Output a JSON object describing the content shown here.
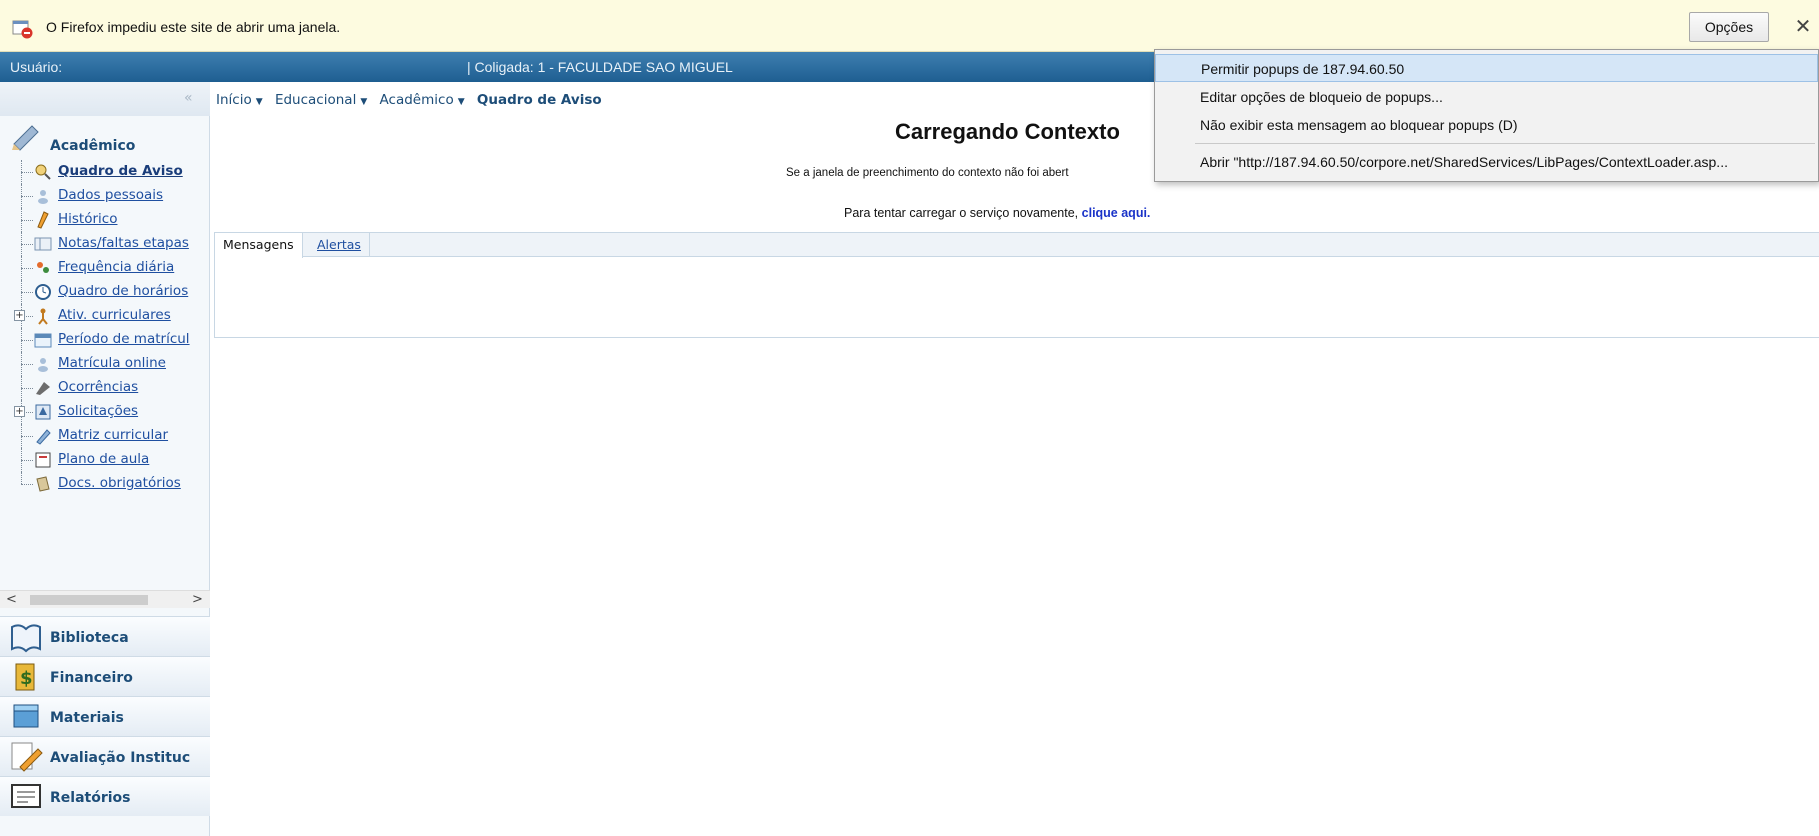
{
  "notification": {
    "text": "O Firefox impediu este site de abrir uma janela.",
    "options_button": "Opções",
    "close": "✕"
  },
  "popup_menu": {
    "items": [
      "Permitir popups de 187.94.60.50",
      "Editar opções de bloqueio de popups...",
      "Não exibir esta mensagem ao bloquear popups (D)",
      "Abrir \"http://187.94.60.50/corpore.net/SharedServices/LibPages/ContextLoader.asp..."
    ]
  },
  "appbar": {
    "user_label": "Usuário:",
    "coligada": "|  Coligada: 1 - FACULDADE SAO MIGUEL"
  },
  "sidebar": {
    "collapse": "«",
    "module_title": "Acadêmico",
    "items": [
      {
        "label": "Quadro de Aviso",
        "active": true
      },
      {
        "label": "Dados pessoais"
      },
      {
        "label": "Histórico"
      },
      {
        "label": "Notas/faltas etapas"
      },
      {
        "label": "Frequência diária"
      },
      {
        "label": "Quadro de horários"
      },
      {
        "label": "Ativ. curriculares",
        "expandable": true
      },
      {
        "label": "Período de matrícul"
      },
      {
        "label": "Matrícula online"
      },
      {
        "label": "Ocorrências"
      },
      {
        "label": "Solicitações",
        "expandable": true
      },
      {
        "label": "Matriz curricular"
      },
      {
        "label": "Plano de aula"
      },
      {
        "label": "Docs. obrigatórios"
      }
    ],
    "modules": [
      "Biblioteca",
      "Financeiro",
      "Materiais",
      "Avaliação Instituc",
      "Relatórios"
    ]
  },
  "breadcrumb": {
    "items": [
      "Início",
      "Educacional",
      "Acadêmico"
    ],
    "current": "Quadro de Aviso"
  },
  "main": {
    "title": "Carregando Contexto",
    "message1": "Se a janela de preenchimento do contexto não foi abert",
    "message2_prefix": "Para tentar carregar o serviço novamente,",
    "message2_link": "clique aqui."
  },
  "tabs": [
    "Mensagens",
    "Alertas"
  ]
}
